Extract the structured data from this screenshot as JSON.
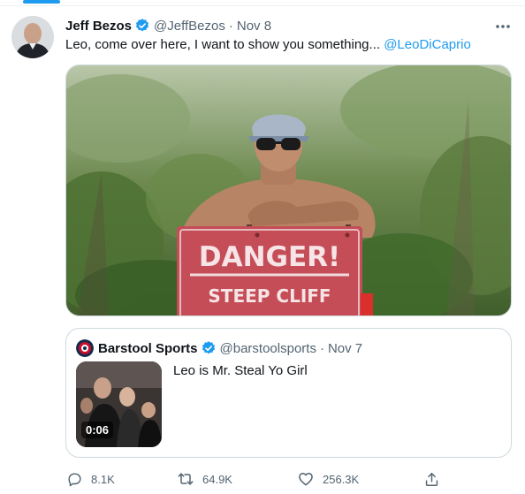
{
  "tweet": {
    "author_name": "Jeff Bezos",
    "author_handle": "@JeffBezos",
    "separator": "·",
    "timestamp": "Nov 8",
    "text": "Leo, come over here, I want to show you something... ",
    "mention": "@LeoDiCaprio",
    "image_sign": {
      "line1": "DANGER!",
      "line2": "STEEP CLIFF"
    }
  },
  "quoted_tweet": {
    "author_name": "Barstool Sports",
    "author_handle": "@barstoolsports",
    "separator": "·",
    "timestamp": "Nov 7",
    "text": "Leo is Mr. Steal Yo Girl",
    "video_duration": "0:06"
  },
  "actions": {
    "reply_count": "8.1K",
    "retweet_count": "64.9K",
    "like_count": "256.3K"
  },
  "colors": {
    "accent": "#1d9bf0",
    "secondary_text": "#536471",
    "border": "#cfd9de"
  },
  "icons": {
    "verified": "verified-badge-icon",
    "more": "more-dots-icon",
    "reply": "reply-bubble-icon",
    "retweet": "retweet-icon",
    "like": "heart-icon",
    "share": "share-upload-icon"
  }
}
